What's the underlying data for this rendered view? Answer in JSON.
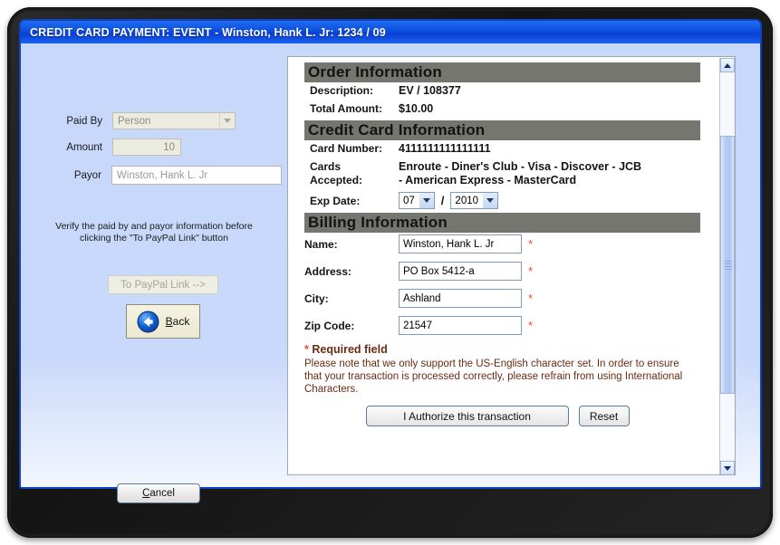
{
  "window": {
    "title": "CREDIT CARD PAYMENT: EVENT - Winston, Hank L. Jr: 1234 / 09"
  },
  "left_pane": {
    "paid_by": {
      "label": "Paid By",
      "value": "Person"
    },
    "amount": {
      "label": "Amount",
      "value": "10"
    },
    "payor": {
      "label": "Payor",
      "value": "Winston, Hank L. Jr"
    },
    "verify_note": "Verify the paid by and payor information before clicking the \"To PayPal Link\" button",
    "paypal_button": "To PayPal Link -->",
    "back_button": "Back",
    "cancel_button": "Cancel"
  },
  "order_information": {
    "heading": "Order Information",
    "description_label": "Description:",
    "description_value": "EV / 108377",
    "total_amount_label": "Total Amount:",
    "total_amount_value": "$10.00"
  },
  "credit_card_information": {
    "heading": "Credit Card Information",
    "card_number_label": "Card Number:",
    "card_number_value": "4111111111111111",
    "cards_accepted_label_line1": "Cards",
    "cards_accepted_label_line2": "Accepted:",
    "cards_accepted_value_line1": "Enroute - Diner's Club - Visa - Discover - JCB",
    "cards_accepted_value_line2": "- American Express - MasterCard",
    "exp_date_label": "Exp Date:",
    "exp_month": "07",
    "exp_year": "2010",
    "exp_separator": "/"
  },
  "billing_information": {
    "heading": "Billing Information",
    "fields": [
      {
        "label": "Name:",
        "value": "Winston, Hank L. Jr",
        "required_marker": "*"
      },
      {
        "label": "Address:",
        "value": "PO Box 5412-a",
        "required_marker": "*"
      },
      {
        "label": "City:",
        "value": "Ashland",
        "required_marker": "*"
      },
      {
        "label": "Zip Code:",
        "value": "21547",
        "required_marker": "*"
      }
    ]
  },
  "footer": {
    "required_star": "*",
    "required_text": "Required field",
    "note": "Please note that we only support the US-English character set. In order to ensure that your transaction is processed correctly, please refrain from using International Characters.",
    "authorize_button": "I Authorize this transaction",
    "reset_button": "Reset"
  },
  "colors": {
    "titlebar_blue": "#0d4fe0",
    "window_body": "#c8d8fa",
    "section_header_gray": "#767670",
    "required_red": "#f0462e",
    "note_brown": "#6a2b10"
  }
}
